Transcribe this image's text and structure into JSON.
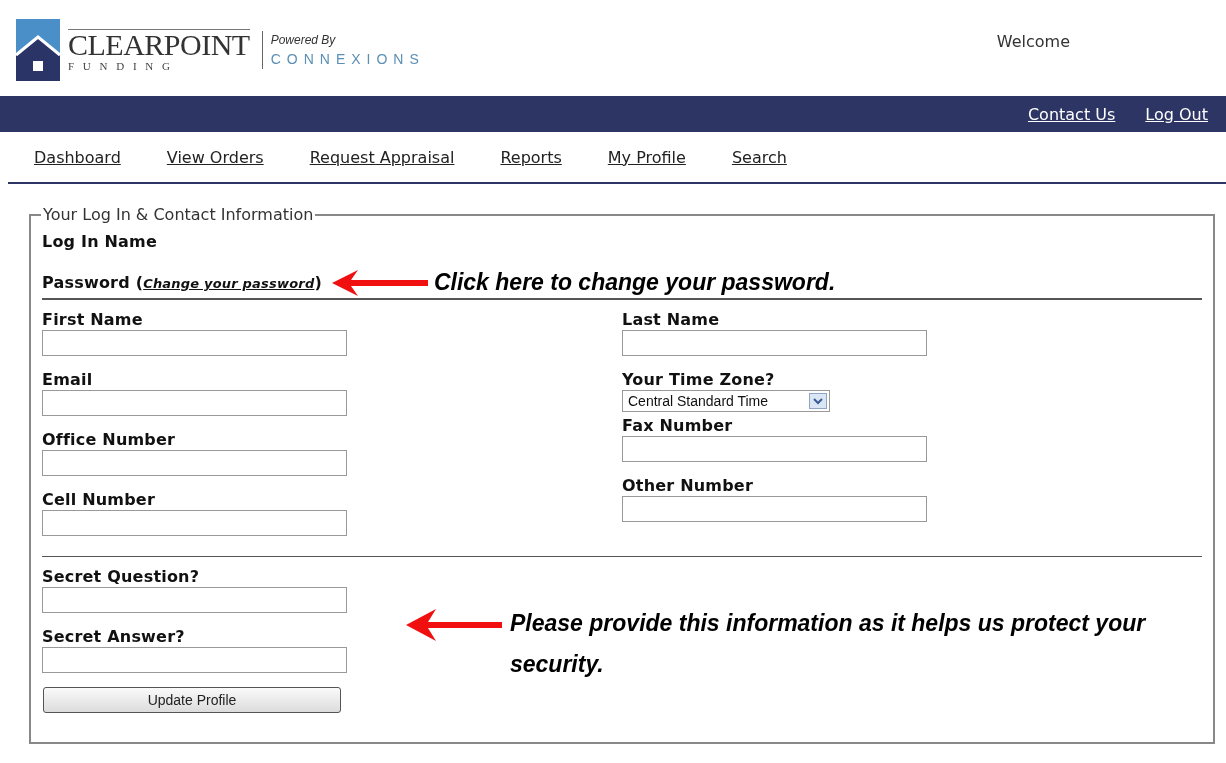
{
  "header": {
    "logo": {
      "name": "CLEARPOINT",
      "sub": "F U N D I N G",
      "powered": "Powered By",
      "brand": "CONNEXIONS"
    },
    "welcome": "Welcome"
  },
  "top_links": [
    "Contact Us",
    "Log Out"
  ],
  "nav": [
    "Dashboard",
    "View Orders",
    "Request Appraisal",
    "Reports",
    "My Profile",
    "Search"
  ],
  "form": {
    "legend": "Your Log In & Contact Information",
    "login_label": "Log In Name",
    "password": {
      "before": "Password (",
      "link": "Change your password",
      "after": ")"
    },
    "password_callout": "Click here to change your password.",
    "left_fields": [
      {
        "kind": "text",
        "label": "First Name"
      },
      {
        "kind": "text",
        "label": "Email"
      },
      {
        "kind": "text",
        "label": "Office Number"
      },
      {
        "kind": "text",
        "label": "Cell Number"
      }
    ],
    "right_fields": [
      {
        "kind": "text",
        "label": "Last Name"
      },
      {
        "kind": "select",
        "label": "Your Time Zone?",
        "value": "Central Standard Time"
      },
      {
        "kind": "text",
        "label": "Fax Number"
      },
      {
        "kind": "text",
        "label": "Other Number"
      }
    ],
    "security_fields": [
      {
        "kind": "text",
        "label": "Secret Question?"
      },
      {
        "kind": "text",
        "label": "Secret Answer?"
      }
    ],
    "security_callout": "Please provide this information as it helps us protect your security.",
    "button": "Update Profile"
  }
}
